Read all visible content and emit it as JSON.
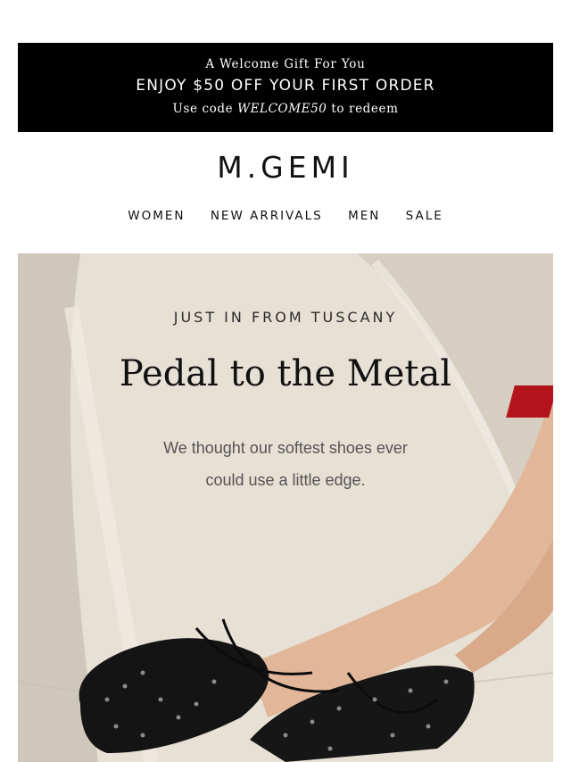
{
  "promo": {
    "kicker": "A Welcome Gift For You",
    "headline": "ENJOY $50 OFF YOUR FIRST ORDER",
    "code_prefix": "Use code",
    "code": "WELCOME50",
    "code_suffix": "to redeem"
  },
  "brand": {
    "logo": "M.GEMI"
  },
  "nav": {
    "items": [
      "WOMEN",
      "NEW ARRIVALS",
      "MEN",
      "SALE"
    ]
  },
  "hero": {
    "eyebrow": "JUST IN FROM TUSCANY",
    "title": "Pedal to the Metal",
    "subtitle_line1": "We thought our softest shoes ever",
    "subtitle_line2": "could use a little edge."
  },
  "colors": {
    "promo_bg": "#000000",
    "accent_red": "#b3141c",
    "stone": "#ddd6ca"
  }
}
